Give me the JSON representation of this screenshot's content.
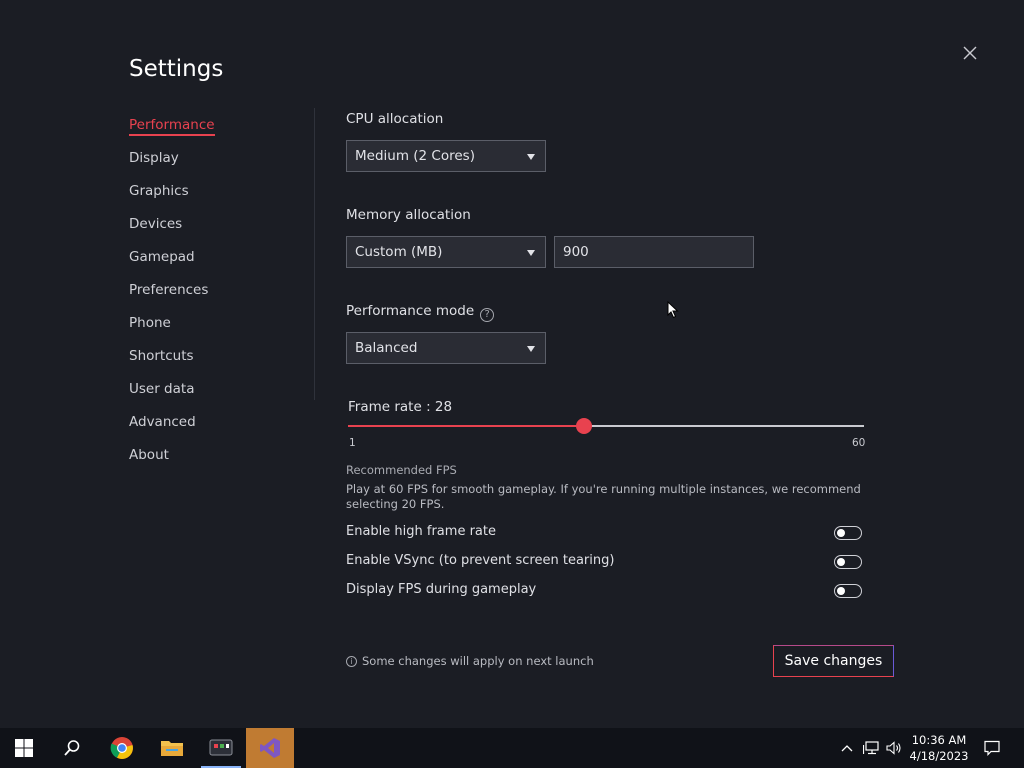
{
  "window": {
    "title": "Settings",
    "close_label": ""
  },
  "nav": {
    "items": [
      {
        "label": "Performance"
      },
      {
        "label": "Display"
      },
      {
        "label": "Graphics"
      },
      {
        "label": "Devices"
      },
      {
        "label": "Gamepad"
      },
      {
        "label": "Preferences"
      },
      {
        "label": "Phone"
      },
      {
        "label": "Shortcuts"
      },
      {
        "label": "User data"
      },
      {
        "label": "Advanced"
      },
      {
        "label": "About"
      }
    ],
    "active": "Performance"
  },
  "performance": {
    "cpu": {
      "label": "CPU allocation",
      "value": "Medium (2 Cores)"
    },
    "memory": {
      "label": "Memory allocation",
      "mode": "Custom (MB)",
      "amount": "900"
    },
    "mode": {
      "label": "Performance mode",
      "help": "?",
      "value": "Balanced"
    },
    "frame_rate": {
      "label": "Frame rate : 28",
      "value": 28,
      "min": 1,
      "max": 60,
      "min_label": "1",
      "max_label": "60"
    },
    "recommended": {
      "title": "Recommended FPS",
      "description": "Play at 60 FPS for smooth gameplay. If you're running multiple instances, we recommend selecting 20 FPS."
    },
    "toggles": [
      {
        "label": "Enable high frame rate",
        "on": false
      },
      {
        "label": "Enable VSync (to prevent screen tearing)",
        "on": false
      },
      {
        "label": "Display FPS during gameplay",
        "on": false
      }
    ],
    "note": "Some changes will apply on next launch",
    "save_label": "Save changes"
  },
  "taskbar": {
    "apps": [
      "windows-start",
      "search",
      "chrome",
      "file-explorer",
      "emulator",
      "visual-studio"
    ],
    "time": "10:36 AM",
    "date": "4/18/2023"
  },
  "colors": {
    "accent": "#e8424f",
    "background": "#1b1d24",
    "taskbar": "#101218"
  }
}
